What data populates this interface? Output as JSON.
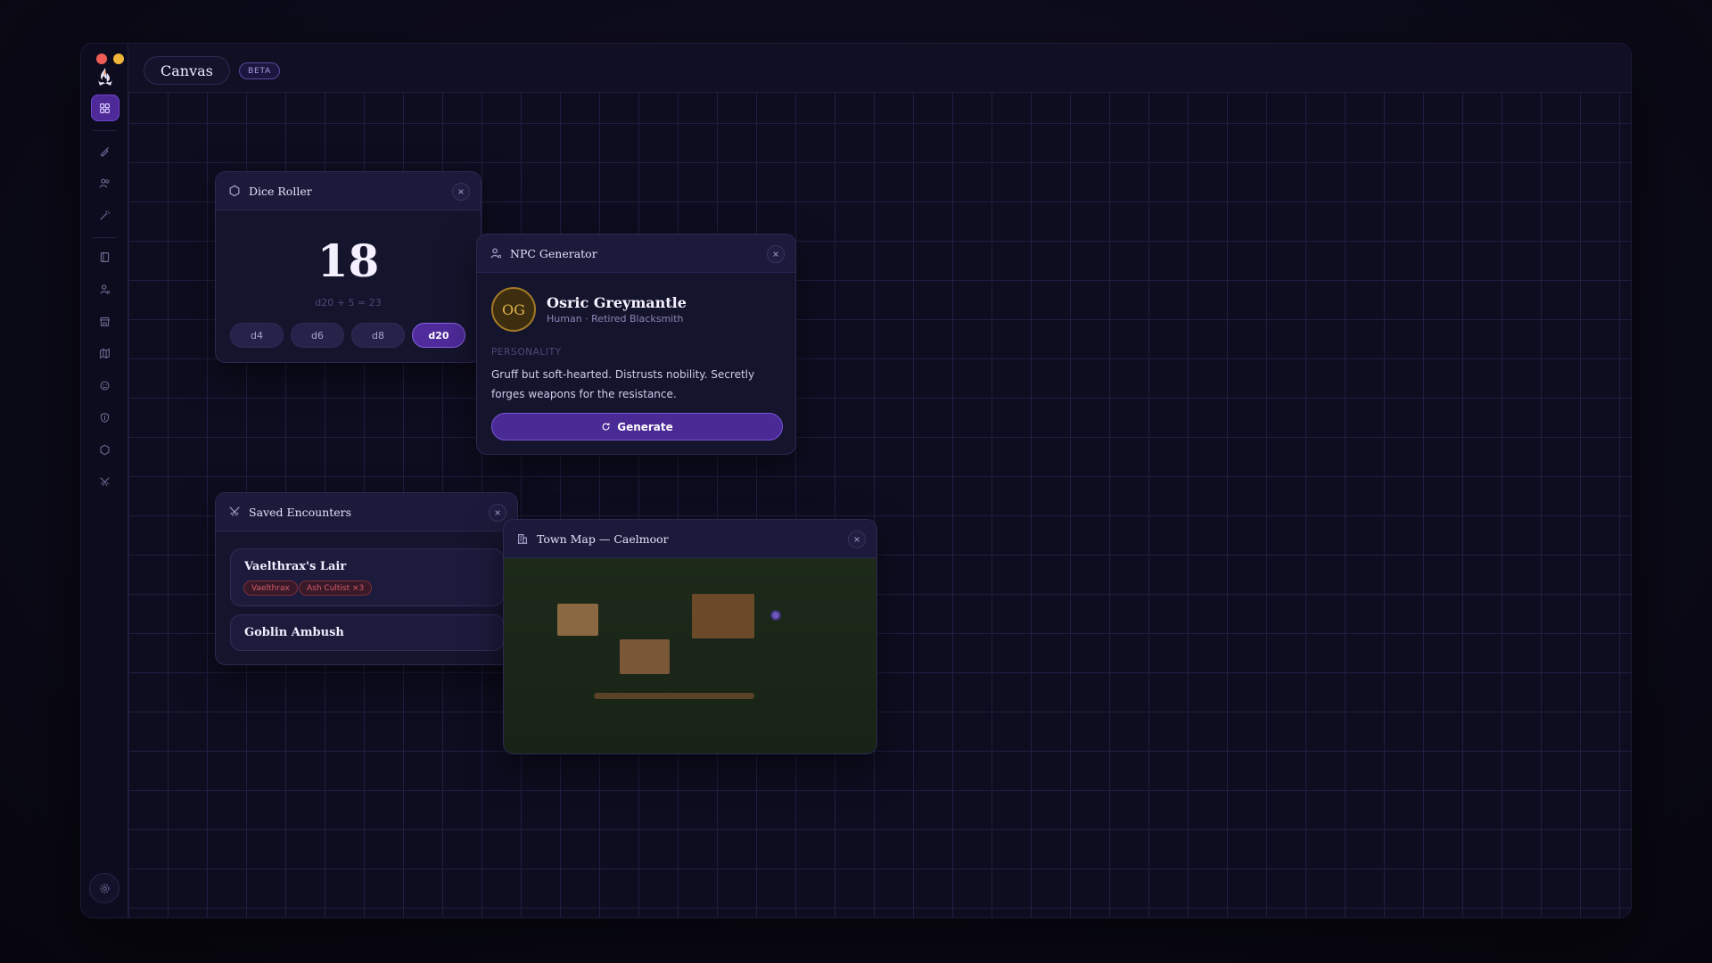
{
  "app": {
    "tab": "Canvas",
    "badge": "BETA"
  },
  "sidebar": {
    "items": [
      {
        "name": "grid-icon",
        "active": true
      },
      {
        "name": "brush-icon"
      },
      {
        "name": "users-icon"
      },
      {
        "name": "wand-icon"
      },
      {
        "name": "book-icon"
      },
      {
        "name": "person-icon"
      },
      {
        "name": "store-icon"
      },
      {
        "name": "map-icon"
      },
      {
        "name": "smile-icon"
      },
      {
        "name": "shield-icon"
      },
      {
        "name": "hexagon-icon"
      },
      {
        "name": "swords-icon"
      }
    ],
    "settings": "settings-icon"
  },
  "dice_roller": {
    "title": "Dice Roller",
    "result": "18",
    "formula": "d20 + 5 = 23",
    "dice": [
      "d4",
      "d6",
      "d8",
      "d20"
    ],
    "active_die": "d20"
  },
  "npc_generator": {
    "title": "NPC Generator",
    "initials": "OG",
    "name": "Osric Greymantle",
    "subtitle": "Human · Retired Blacksmith",
    "section_label": "PERSONALITY",
    "personality": "Gruff but soft-hearted. Distrusts nobility. Secretly forges weapons for the resistance.",
    "button": "Generate"
  },
  "saved_encounters": {
    "title": "Saved Encounters",
    "items": [
      {
        "name": "Vaelthrax's Lair",
        "tags": [
          "Vaelthrax",
          "Ash Cultist ×3"
        ]
      },
      {
        "name": "Goblin Ambush",
        "tags": []
      }
    ]
  },
  "town_map": {
    "title": "Town Map — Caelmoor"
  },
  "colors": {
    "accent": "#4f2b9b",
    "tag_red": "#d05b66",
    "avatar_gold": "#a57a24",
    "map_green": "#1d2a1a"
  }
}
